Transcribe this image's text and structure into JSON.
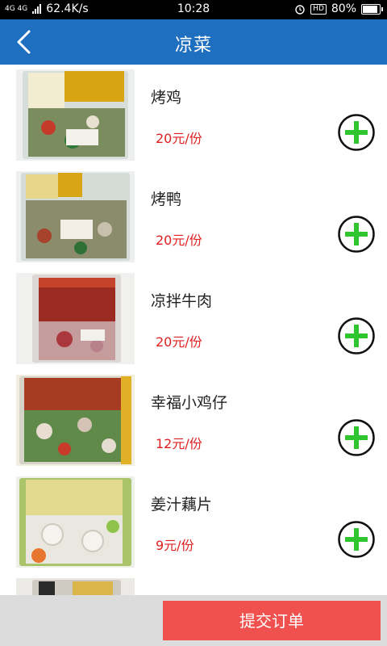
{
  "status_bar": {
    "network": "4G 4G",
    "speed": "62.4K/s",
    "time": "10:28",
    "hd": "HD",
    "battery": "80%",
    "battery_level": 0.8
  },
  "header": {
    "title": "凉菜",
    "back_icon": "chevron-left-icon",
    "color": "#1f6fc0"
  },
  "items": [
    {
      "name": "烤鸡",
      "price": "20元/份",
      "image": "packaged-roast-chicken-photo"
    },
    {
      "name": "烤鸭",
      "price": "20元/份",
      "image": "packaged-roast-duck-photo"
    },
    {
      "name": "凉拌牛肉",
      "price": "20元/份",
      "image": "packaged-cold-beef-photo"
    },
    {
      "name": "幸福小鸡仔",
      "price": "12元/份",
      "image": "packaged-chicken-photo"
    },
    {
      "name": "姜汁藕片",
      "price": "9元/份",
      "image": "packaged-lotus-root-photo"
    },
    {
      "name": "",
      "price": "",
      "image": "packaged-dish-photo"
    }
  ],
  "add_icon": "plus-circle-icon",
  "colors": {
    "price": "#e02020",
    "add": "#2ec52e",
    "submit": "#f0514f"
  },
  "footer": {
    "submit_label": "提交订单"
  }
}
